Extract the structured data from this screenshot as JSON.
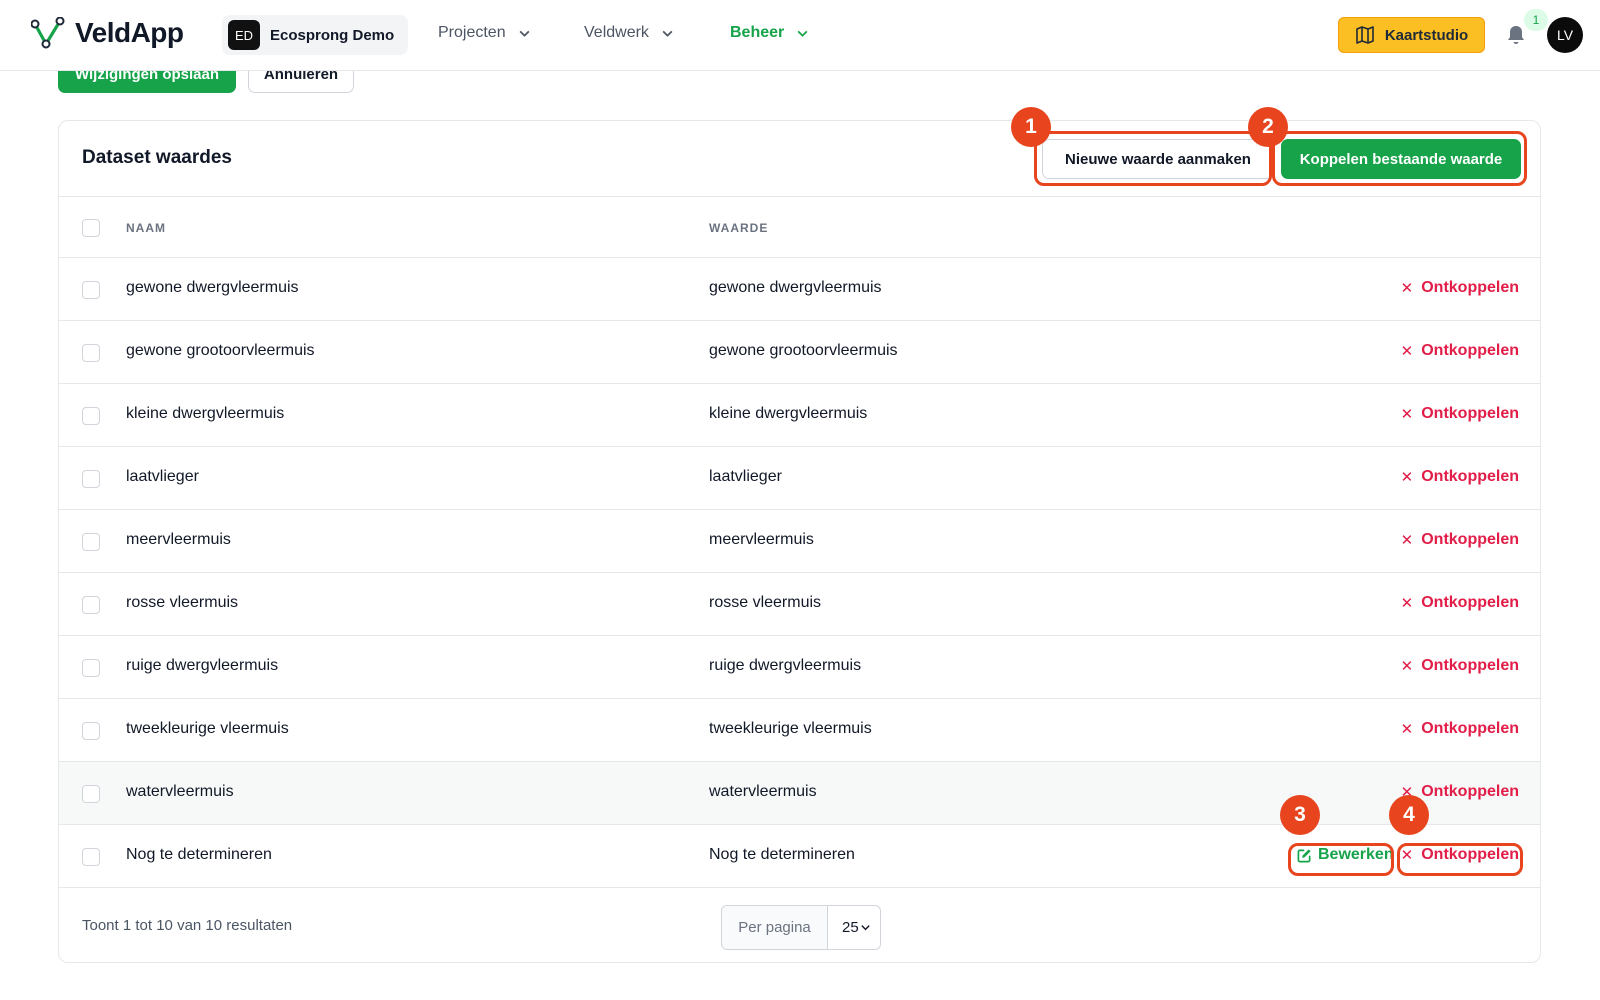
{
  "app": {
    "logo_text": "VeldApp"
  },
  "org": {
    "badge": "ED",
    "name": "Ecosprong Demo"
  },
  "nav": {
    "projects": "Projecten",
    "fieldwork": "Veldwerk",
    "admin": "Beheer"
  },
  "header": {
    "map_button": "Kaartstudio",
    "notification_count": "1",
    "avatar_initials": "LV"
  },
  "form_actions": {
    "save": "Wijzigingen opslaan",
    "cancel": "Annuleren"
  },
  "card": {
    "title": "Dataset waardes",
    "new_button": "Nieuwe waarde aanmaken",
    "link_button": "Koppelen bestaande waarde"
  },
  "table": {
    "columns": {
      "name": "NAAM",
      "value": "WAARDE"
    },
    "unlink_label": "Ontkoppelen",
    "edit_label": "Bewerken",
    "rows": [
      {
        "name": "gewone dwergvleermuis",
        "value": "gewone dwergvleermuis"
      },
      {
        "name": "gewone grootoorvleermuis",
        "value": "gewone grootoorvleermuis"
      },
      {
        "name": "kleine dwergvleermuis",
        "value": "kleine dwergvleermuis"
      },
      {
        "name": "laatvlieger",
        "value": "laatvlieger"
      },
      {
        "name": "meervleermuis",
        "value": "meervleermuis"
      },
      {
        "name": "rosse vleermuis",
        "value": "rosse vleermuis"
      },
      {
        "name": "ruige dwergvleermuis",
        "value": "ruige dwergvleermuis"
      },
      {
        "name": "tweekleurige vleermuis",
        "value": "tweekleurige vleermuis"
      },
      {
        "name": "watervleermuis",
        "value": "watervleermuis"
      },
      {
        "name": "Nog te determineren",
        "value": "Nog te determineren"
      }
    ]
  },
  "footer": {
    "results_text": "Toont 1 tot 10 van 10 resultaten",
    "per_page_label": "Per pagina",
    "per_page_value": "25"
  },
  "annotations": {
    "m1": "1",
    "m2": "2",
    "m3": "3",
    "m4": "4"
  },
  "colors": {
    "brand_green": "#16a34a",
    "danger": "#e11d48",
    "annotation": "#e8441e",
    "accent_yellow": "#fbbf24"
  }
}
